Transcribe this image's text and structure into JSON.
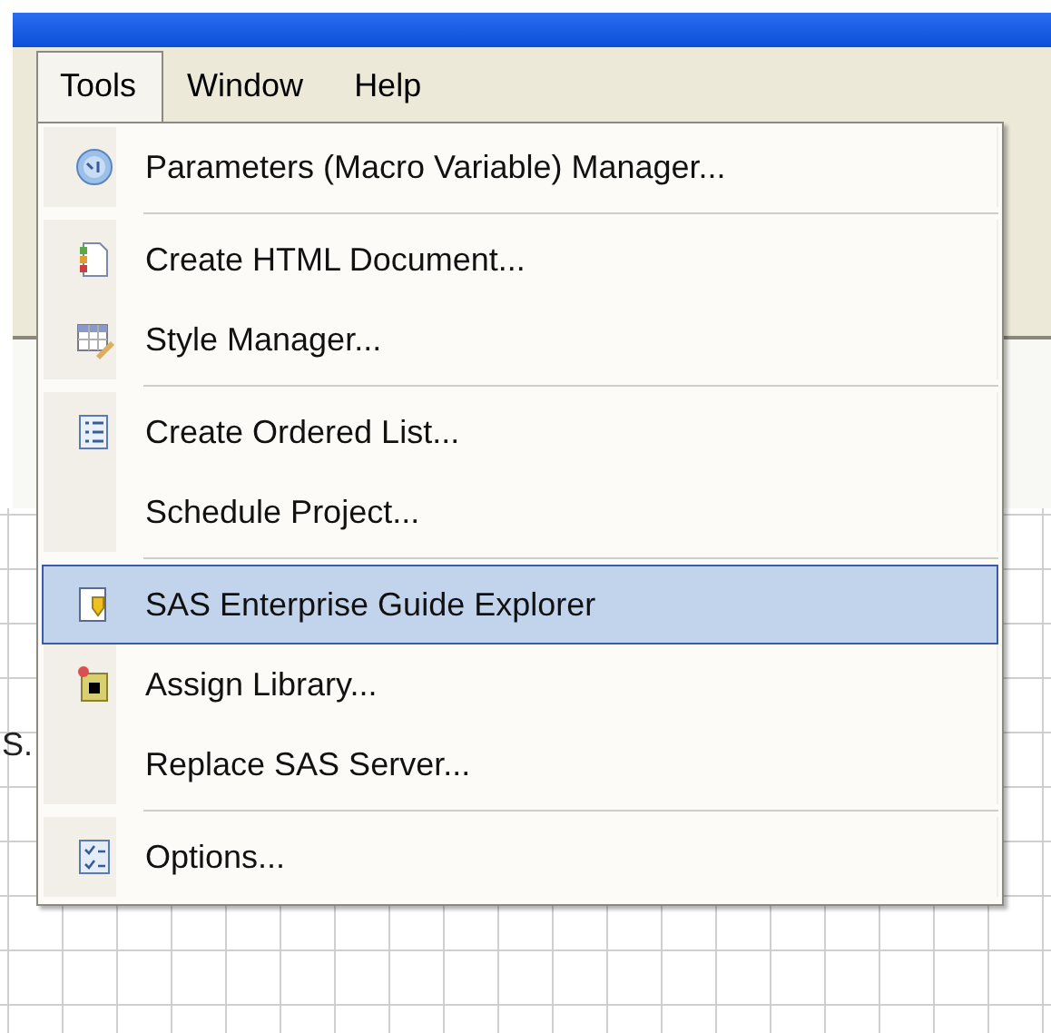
{
  "menu_bar": [
    {
      "label": "Tools",
      "selected": true
    },
    {
      "label": "Window",
      "selected": false
    },
    {
      "label": "Help",
      "selected": false
    }
  ],
  "background_text": "S.",
  "menu": [
    {
      "kind": "item",
      "label": "Parameters (Macro Variable) Manager...",
      "selected": false
    },
    {
      "kind": "separator"
    },
    {
      "kind": "item",
      "label": "Create HTML Document...",
      "selected": false
    },
    {
      "kind": "item",
      "label": "Style Manager...",
      "selected": false
    },
    {
      "kind": "separator"
    },
    {
      "kind": "item",
      "label": "Create Ordered List...",
      "selected": false
    },
    {
      "kind": "item",
      "label": "Schedule Project...",
      "selected": false
    },
    {
      "kind": "separator"
    },
    {
      "kind": "item",
      "label": "SAS Enterprise Guide Explorer",
      "selected": true
    },
    {
      "kind": "item",
      "label": "Assign Library...",
      "selected": false
    },
    {
      "kind": "item",
      "label": "Replace SAS Server...",
      "selected": false
    },
    {
      "kind": "separator"
    },
    {
      "kind": "item",
      "label": "Options...",
      "selected": false
    }
  ]
}
